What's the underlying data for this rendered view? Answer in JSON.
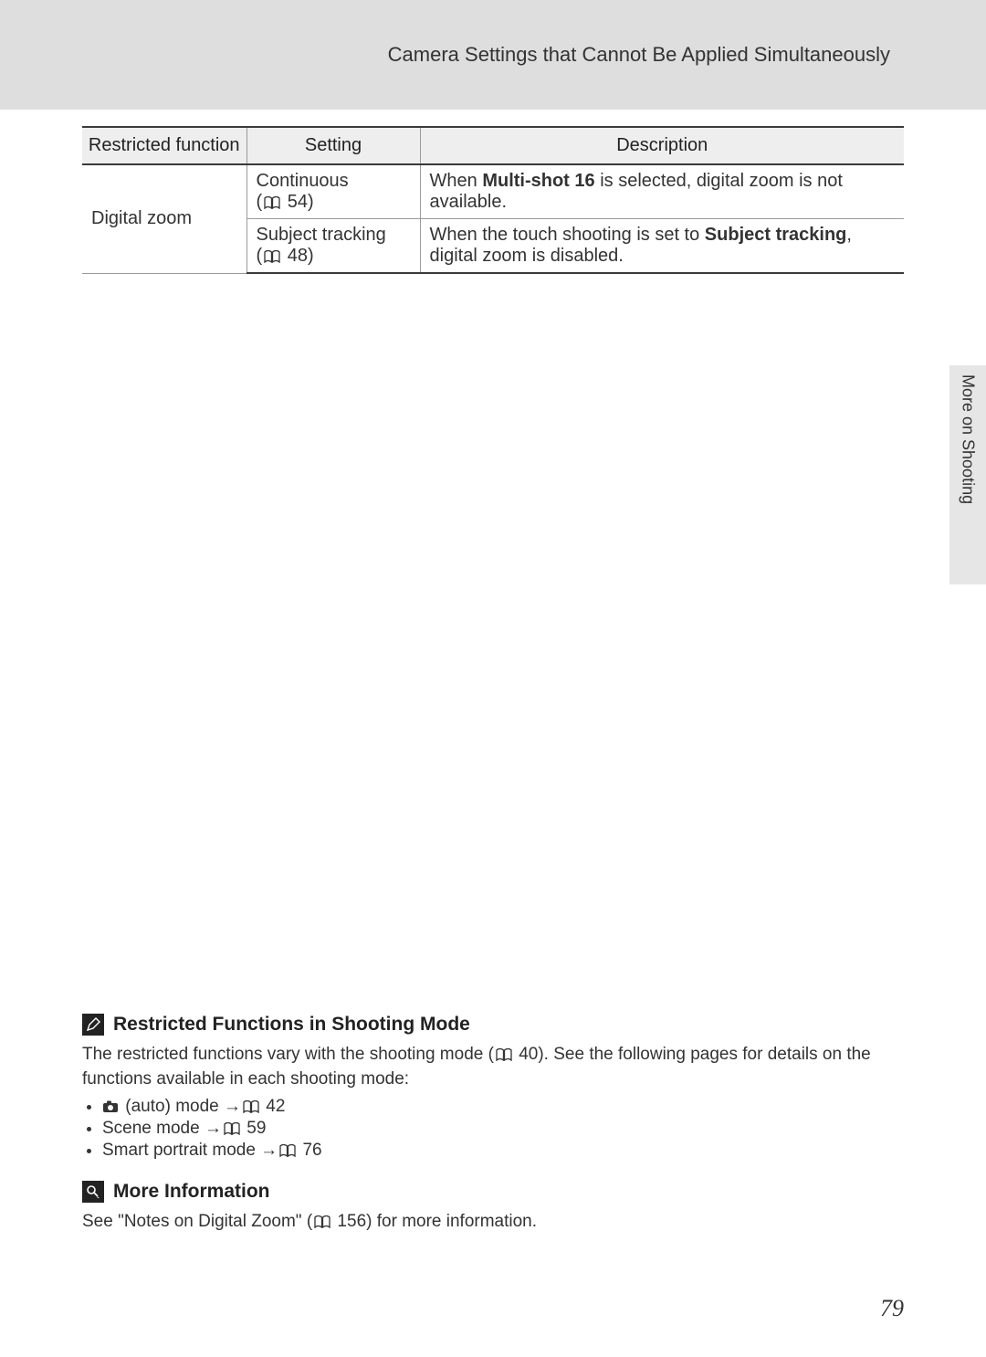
{
  "header": {
    "title": "Camera Settings that Cannot Be Applied Simultaneously"
  },
  "table": {
    "headers": {
      "restricted": "Restricted function",
      "setting": "Setting",
      "description": "Description"
    },
    "rows": [
      {
        "restricted": "Digital zoom",
        "setting_name": "Continuous",
        "setting_ref_prefix": "(",
        "setting_ref_page": " 54)",
        "desc_pre": "When ",
        "desc_bold": "Multi-shot 16",
        "desc_post": " is selected, digital zoom is not available."
      },
      {
        "setting_name": "Subject tracking",
        "setting_ref_prefix": "(",
        "setting_ref_page": " 48)",
        "desc_pre": "When the touch shooting is set to ",
        "desc_bold": "Subject tracking",
        "desc_post": ", digital zoom is disabled."
      }
    ]
  },
  "side_tab": "More on Shooting",
  "notes": {
    "restricted": {
      "heading": "Restricted Functions in Shooting Mode",
      "body_pre": "The restricted functions vary with the shooting mode (",
      "body_ref": " 40). See the following pages for details on the functions available in each shooting mode:",
      "modes": [
        {
          "label_pre": "",
          "label": " (auto) mode ",
          "arrow": "→",
          "page": " 42",
          "has_camera": true
        },
        {
          "label_pre": "Scene mode ",
          "label": "",
          "arrow": "→",
          "page": " 59",
          "has_camera": false
        },
        {
          "label_pre": "Smart portrait mode ",
          "label": "",
          "arrow": "→",
          "page": " 76",
          "has_camera": false
        }
      ]
    },
    "more_info": {
      "heading": "More Information",
      "body_pre": "See \"Notes on Digital Zoom\" (",
      "body_post": " 156) for more information."
    }
  },
  "page_number": "79"
}
